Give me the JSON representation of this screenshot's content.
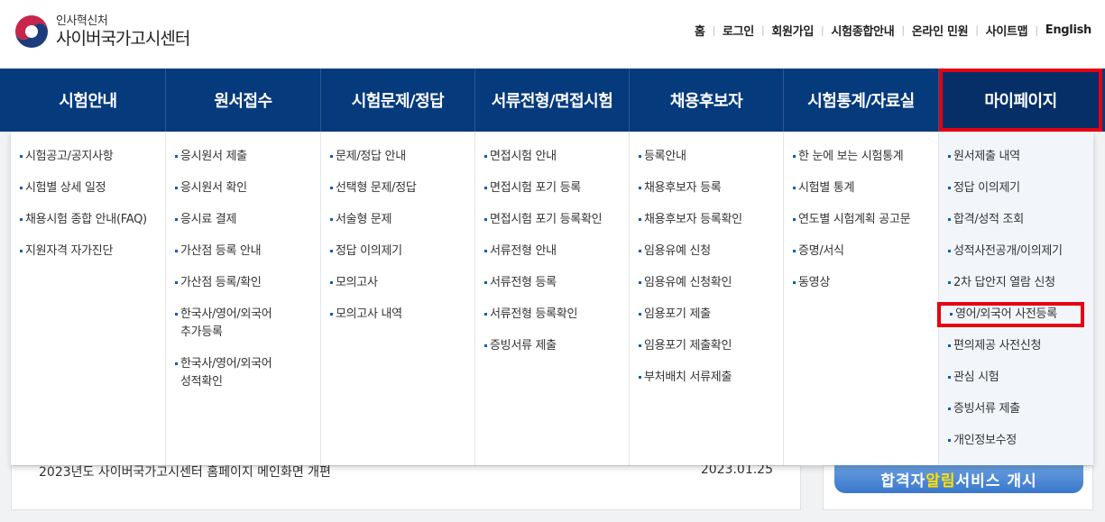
{
  "header": {
    "logo_sub": "인사혁신처",
    "logo_main": "사이버국가고시센터",
    "utils": [
      "홈",
      "로그인",
      "회원가입",
      "시험종합안내",
      "온라인 민원",
      "사이트맵",
      "English"
    ]
  },
  "gnb": [
    {
      "label": "시험안내",
      "items": [
        "시험공고/공지사항",
        "시험별 상세 일정",
        "채용시험 종합 안내(FAQ)",
        "지원자격 자가진단"
      ]
    },
    {
      "label": "원서접수",
      "items": [
        "응시원서 제출",
        "응시원서 확인",
        "응시료 결제",
        "가산점 등록 안내",
        "가산점 등록/확인",
        "한국사/영어/외국어|추가등록",
        "한국사/영어/외국어|성적확인"
      ]
    },
    {
      "label": "시험문제/정답",
      "items": [
        "문제/정답 안내",
        "선택형 문제/정답",
        "서술형 문제",
        "정답 이의제기",
        "모의고사",
        "모의고사 내역"
      ]
    },
    {
      "label": "서류전형/면접시험",
      "items": [
        "면접시험 안내",
        "면접시험 포기 등록",
        "면접시험 포기 등록확인",
        "서류전형 안내",
        "서류전형 등록",
        "서류전형 등록확인",
        "증빙서류 제출"
      ]
    },
    {
      "label": "채용후보자",
      "items": [
        "등록안내",
        "채용후보자 등록",
        "채용후보자 등록확인",
        "임용유예 신청",
        "임용유예 신청확인",
        "임용포기 제출",
        "임용포기 제출확인",
        "부처배치 서류제출"
      ]
    },
    {
      "label": "시험통계/자료실",
      "items": [
        "한 눈에 보는 시험통계",
        "시험별 통계",
        "연도별 시험계획 공고문",
        "증명/서식",
        "동영상"
      ]
    },
    {
      "label": "마이페이지",
      "items": [
        "원서제출 내역",
        "정답 이의제기",
        "합격/성적 조회",
        "성적사전공개/이의제기",
        "2차 답안지 열람 신청",
        "영어/외국어 사전등록",
        "편의제공 사전신청",
        "관심 시험",
        "증빙서류 제출",
        "개인정보수정"
      ]
    }
  ],
  "below": {
    "notice_title": "2023년도 사이버국가고시센터 홈페이지 메인화면 개편",
    "notice_date": "2023.01.25",
    "banner_pre": "합격자 ",
    "banner_hl": "알림",
    "banner_post": " 서비스 개시"
  },
  "colors": {
    "gnb_bg": "#053a7d",
    "highlight": "#e60012"
  }
}
